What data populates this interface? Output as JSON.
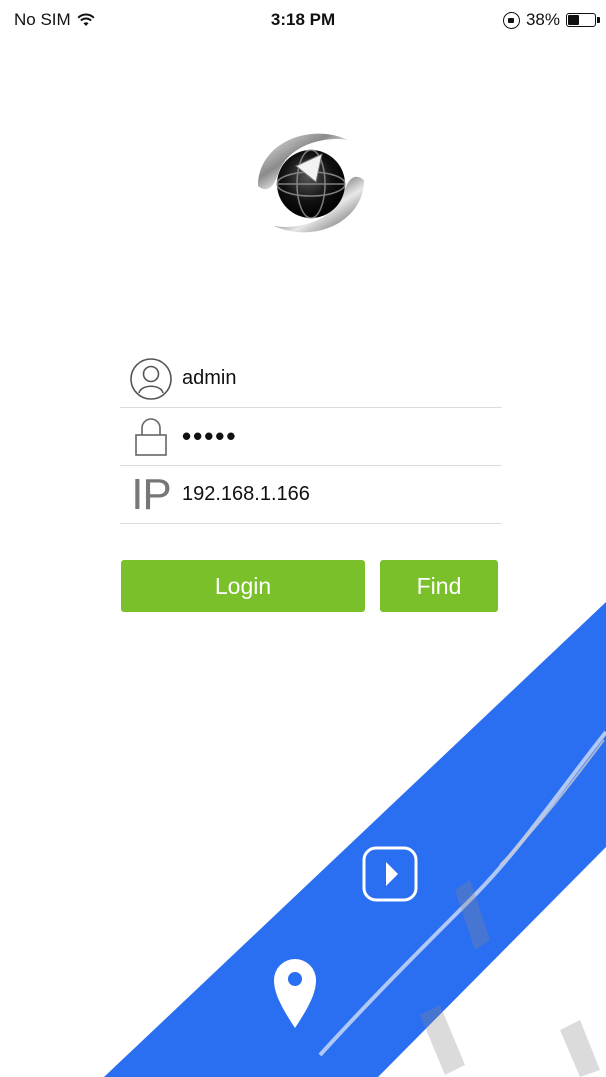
{
  "status_bar": {
    "carrier": "No SIM",
    "time": "3:18 PM",
    "battery_percent": "38%",
    "battery_level": 0.38
  },
  "login_form": {
    "username_value": "admin",
    "password_value": "•••••",
    "ip_value": "192.168.1.166",
    "ip_icon_text": "IP"
  },
  "buttons": {
    "login_label": "Login",
    "find_label": "Find"
  },
  "icons": {
    "wifi": "wifi-icon",
    "orientation_lock": "orientation-lock-icon",
    "battery": "battery-icon",
    "user": "user-icon",
    "lock": "lock-icon",
    "play": "play-icon",
    "location": "location-pin-icon"
  },
  "colors": {
    "button_green": "#79c02a",
    "banner_blue": "#2a6ff2",
    "divider": "#dcdcdc"
  }
}
